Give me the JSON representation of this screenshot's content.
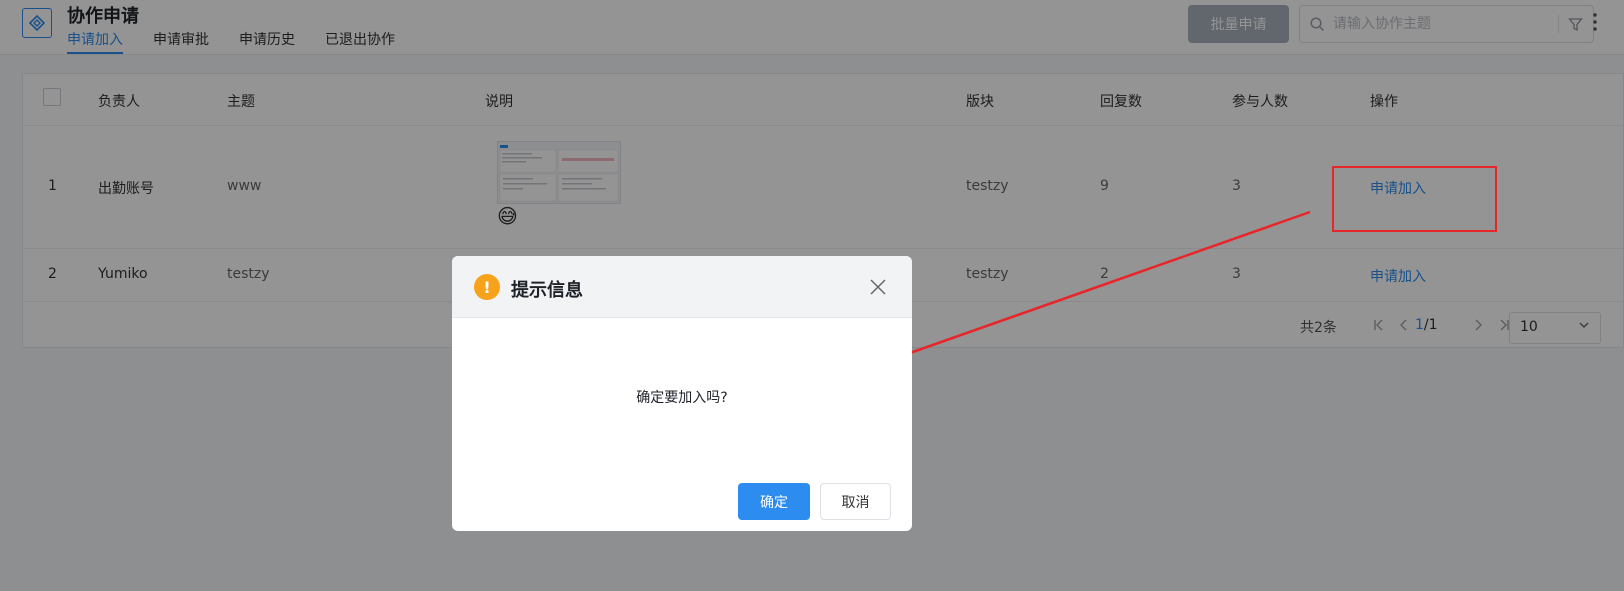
{
  "header": {
    "title": "协作申请",
    "tabs": [
      {
        "label": "申请加入",
        "active": true
      },
      {
        "label": "申请审批",
        "active": false
      },
      {
        "label": "申请历史",
        "active": false
      },
      {
        "label": "已退出协作",
        "active": false
      }
    ],
    "batch_label": "批量申请",
    "search_placeholder": "请输入协作主题"
  },
  "table": {
    "columns": [
      "负责人",
      "主题",
      "说明",
      "版块",
      "回复数",
      "参与人数",
      "操作"
    ],
    "rows": [
      {
        "index": "1",
        "owner": "出勤账号",
        "topic": "www",
        "has_image": true,
        "emoji": "😅",
        "section": "testzy",
        "replies": "9",
        "participants": "3",
        "action": "申请加入"
      },
      {
        "index": "2",
        "owner": "Yumiko",
        "topic": "testzy",
        "has_image": false,
        "emoji": "",
        "section": "testzy",
        "replies": "2",
        "participants": "3",
        "action": "申请加入"
      }
    ]
  },
  "pagination": {
    "total": "共2条",
    "current": "1",
    "pages": "/1",
    "page_size": "10"
  },
  "dialog": {
    "title": "提示信息",
    "message": "确定要加入吗?",
    "ok_label": "确定",
    "cancel_label": "取消"
  },
  "colors": {
    "accent": "#2d8cf0",
    "warning": "#f7a21b",
    "annotation": "#e8262a"
  }
}
